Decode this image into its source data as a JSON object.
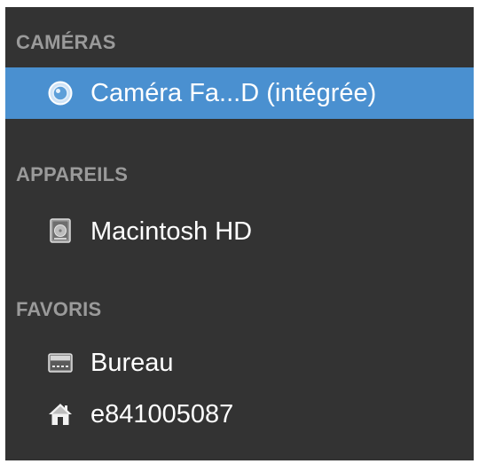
{
  "sidebar": {
    "sections": [
      {
        "header": "CAMÉRAS",
        "items": [
          {
            "label": "Caméra Fa...D (intégrée)",
            "icon": "camera-icon",
            "selected": true
          }
        ]
      },
      {
        "header": "APPAREILS",
        "items": [
          {
            "label": "Macintosh HD",
            "icon": "hard-drive-icon",
            "selected": false
          }
        ]
      },
      {
        "header": "FAVORIS",
        "items": [
          {
            "label": "Bureau",
            "icon": "desktop-folder-icon",
            "selected": false
          },
          {
            "label": "e841005087",
            "icon": "home-icon",
            "selected": false
          }
        ]
      }
    ]
  },
  "colors": {
    "background": "#333333",
    "selection": "#4a90d0",
    "header_text": "#9a9a9a",
    "item_text": "#ffffff"
  }
}
